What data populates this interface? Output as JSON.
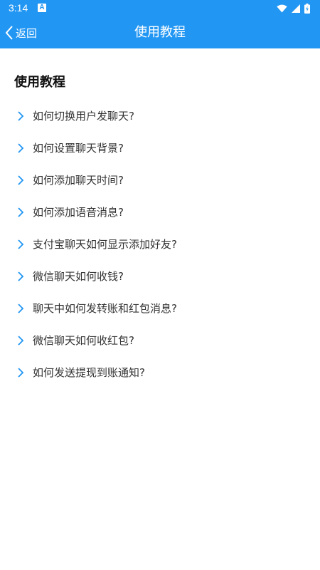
{
  "status_bar": {
    "time": "3:14",
    "notification_icon": "a-icon",
    "icons": [
      "wifi-icon",
      "signal-icon",
      "battery-icon"
    ]
  },
  "header": {
    "back_label": "返回",
    "title": "使用教程"
  },
  "colors": {
    "accent": "#2196f3",
    "chevron": "#2196f3",
    "text": "#333333"
  },
  "main": {
    "section_title": "使用教程",
    "items": [
      {
        "label": "如何切换用户发聊天?"
      },
      {
        "label": "如何设置聊天背景?"
      },
      {
        "label": "如何添加聊天时间?"
      },
      {
        "label": "如何添加语音消息?"
      },
      {
        "label": "支付宝聊天如何显示添加好友?"
      },
      {
        "label": "微信聊天如何收钱?"
      },
      {
        "label": "聊天中如何发转账和红包消息?"
      },
      {
        "label": "微信聊天如何收红包?"
      },
      {
        "label": "如何发送提现到账通知?"
      }
    ]
  }
}
